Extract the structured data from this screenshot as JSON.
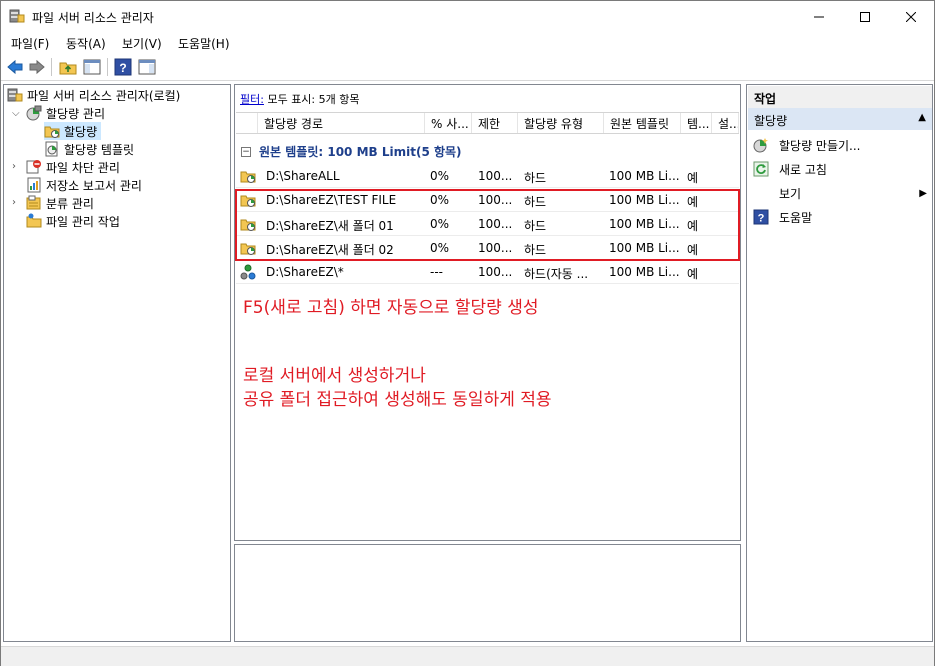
{
  "window": {
    "title": "파일 서버 리소스 관리자"
  },
  "menu": [
    "파일(F)",
    "동작(A)",
    "보기(V)",
    "도움말(H)"
  ],
  "tree": {
    "root": "파일 서버 리소스 관리자(로컬)",
    "quota_mgmt": "할당량 관리",
    "quota": "할당량",
    "quota_templates": "할당량 템플릿",
    "file_screening": "파일 차단 관리",
    "storage_reports": "저장소 보고서 관리",
    "classification": "분류 관리",
    "file_mgmt_tasks": "파일 관리 작업"
  },
  "filter": {
    "link": "필터:",
    "text": "모두 표시: 5개 항목"
  },
  "columns": [
    "할당량 경로",
    "% 사...",
    "제한",
    "할당량 유형",
    "원본 템플릿",
    "템...",
    "설..."
  ],
  "group_label": "원본 템플릿: 100 MB Limit(5 항목)",
  "rows": [
    {
      "path": "D:\\ShareALL",
      "percent": "0%",
      "limit": "100...",
      "type": "하드",
      "template": "100 MB Li...",
      "match": "예"
    },
    {
      "path": "D:\\ShareEZ\\TEST FILE",
      "percent": "0%",
      "limit": "100...",
      "type": "하드",
      "template": "100 MB Li...",
      "match": "예"
    },
    {
      "path": "D:\\ShareEZ\\새 폴더 01",
      "percent": "0%",
      "limit": "100...",
      "type": "하드",
      "template": "100 MB Li...",
      "match": "예"
    },
    {
      "path": "D:\\ShareEZ\\새 폴더 02",
      "percent": "0%",
      "limit": "100...",
      "type": "하드",
      "template": "100 MB Li...",
      "match": "예"
    },
    {
      "path": "D:\\ShareEZ\\*",
      "percent": "---",
      "limit": "100...",
      "type": "하드(자동 ...",
      "template": "100 MB Li...",
      "match": "예"
    }
  ],
  "annotations": {
    "line1": "F5(새로 고침) 하면 자동으로 할당량 생성",
    "line2": "로컬 서버에서 생성하거나",
    "line3": "공유 폴더 접근하여 생성해도 동일하게 적용",
    "color": "#e01b24"
  },
  "actions": {
    "title": "작업",
    "section": "할당량",
    "items": [
      "할당량 만들기...",
      "새로 고침",
      "보기",
      "도움말"
    ]
  }
}
